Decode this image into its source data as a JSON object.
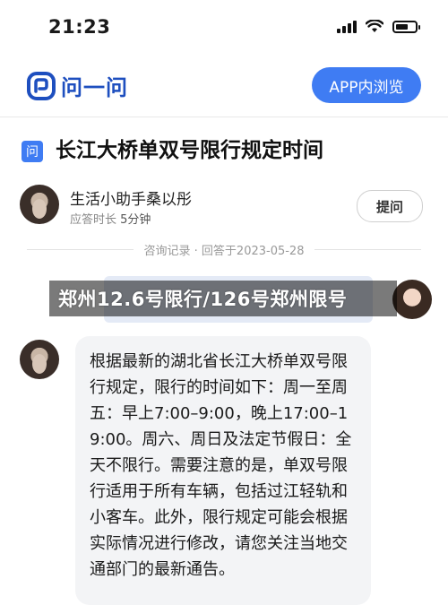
{
  "status_bar": {
    "time": "21:23"
  },
  "header": {
    "logo_text": "问一问",
    "app_button_label": "APP内浏览"
  },
  "question": {
    "badge": "问",
    "title": "长江大桥单双号限行规定时间"
  },
  "answerer": {
    "name": "生活小助手桑以彤",
    "meta_label": "应答时长",
    "meta_value": "5分钟",
    "ask_button_label": "提问"
  },
  "record": {
    "text": "咨询记录 · 回答于2023-05-28"
  },
  "banner": {
    "text": "郑州12.6号限行/126号郑州限号"
  },
  "answer": {
    "text": "根据最新的湖北省长江大桥单双号限行规定，限行的时间如下：周一至周五：早上7:00–9:00，晚上17:00–19:00。周六、周日及法定节假日：全天不限行。需要注意的是，单双号限行适用于所有车辆，包括过江轻轨和小客车。此外，限行规定可能会根据实际情况进行修改，请您关注当地交通部门的最新通告。"
  }
}
